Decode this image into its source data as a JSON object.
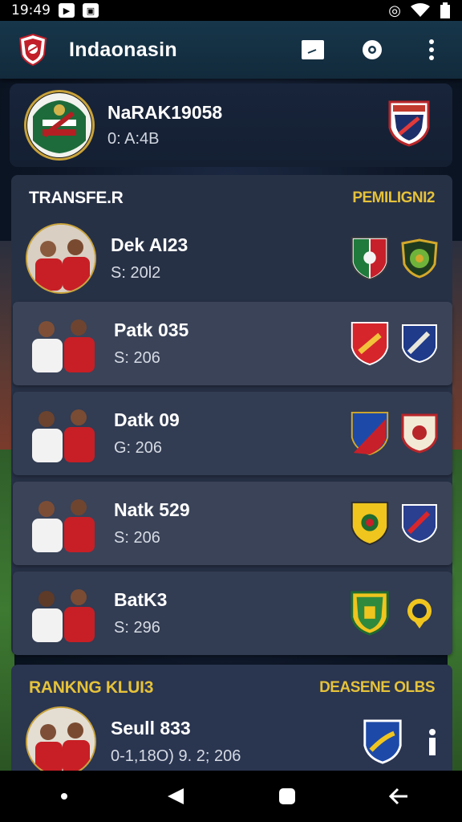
{
  "status_bar": {
    "time": "19:49",
    "icons": [
      "play-icon",
      "photo-icon",
      "location-icon",
      "wifi-icon",
      "battery-icon"
    ]
  },
  "app_bar": {
    "title": "Indaonasin",
    "logo": "club-shield-logo",
    "actions": [
      "message-icon",
      "location-pin-icon",
      "more-vertical-icon"
    ]
  },
  "profile": {
    "name": "NaRAK19058",
    "sub": "0: A:4B"
  },
  "transfer": {
    "title": "TRANSFE.R",
    "link": "PEMILIGNI2",
    "rows": [
      {
        "name": "Dek AI23",
        "sub": "S: 20l2"
      },
      {
        "name": "Patk 035",
        "sub": "S: 206"
      },
      {
        "name": "Datk 09",
        "sub": "G: 206"
      },
      {
        "name": "Natk 529",
        "sub": "S: 206"
      },
      {
        "name": "BatK3",
        "sub": "S: 296"
      }
    ]
  },
  "ranking": {
    "title": "RANKNG KLUI3",
    "link": "DEASENE OLBS",
    "rows": [
      {
        "name": "Seull 833",
        "sub": "0-1,18O)   9. 2; 206"
      }
    ]
  },
  "colors": {
    "accent_yellow": "#e5c23a",
    "panel": "#273146",
    "row": "#323c52",
    "appbar": "#17364a"
  }
}
